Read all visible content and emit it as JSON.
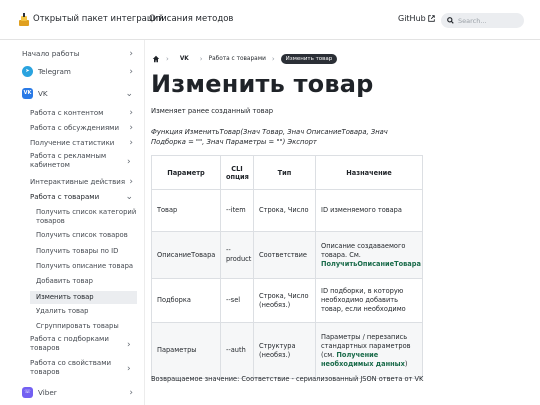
{
  "header": {
    "brand": "Открытый пакет интеграций",
    "nav_methods": "Описания методов",
    "github": "GitHub",
    "search_placeholder": "Search..."
  },
  "sidebar": {
    "start": "Начало работы",
    "telegram": "Telegram",
    "vk": "VK",
    "groups": [
      "Работа с контентом",
      "Работа с обсуждениями",
      "Получение статистики",
      "Работа с рекламным кабинетом",
      "Интерактивные действия",
      "Работа с товарами"
    ],
    "leaves": [
      "Получить список категорий товаров",
      "Получить список товаров",
      "Получить товары по ID",
      "Получить описание товара",
      "Добавить товар",
      "Изменить товар",
      "Удалить товар",
      "Сгруппировать товары"
    ],
    "after": [
      "Работа с подборками товаров",
      "Работа со свойствами товаров"
    ],
    "viber": "Viber"
  },
  "breadcrumbs": {
    "home_icon": "home-icon",
    "vk": "VK",
    "section": "Работа с товарами",
    "current": "Изменить товар"
  },
  "page": {
    "title": "Изменить товар",
    "description": "Изменяет ранее созданный товар",
    "signature": "Функция ИзменитьТовар(Знач Товар, Знач ОписаниеТовара, Знач Подборка = \"\", Знач Параметры = \"\") Экспорт",
    "table": {
      "headers": [
        "Параметр",
        "CLI опция",
        "Тип",
        "Назначение"
      ],
      "rows": [
        {
          "param": "Товар",
          "cli": "--item",
          "type": "Строка, Число",
          "purpose": "ID изменяемого товара",
          "link": "",
          "tail": ""
        },
        {
          "param": "ОписаниеТовара",
          "cli": "--product",
          "type": "Соответствие",
          "purpose": "Описание создаваемого товара. См.",
          "link": "ПолучитьОписаниеТовара",
          "tail": ""
        },
        {
          "param": "Подборка",
          "cli": "--sel",
          "type": "Строка, Число (необяз.)",
          "purpose": "ID подборки, в которую необходимо добавить товар, если необходимо",
          "link": "",
          "tail": ""
        },
        {
          "param": "Параметры",
          "cli": "--auth",
          "type": "Структура (необяз.)",
          "purpose": "Параметры / перезапись стандартных параметров (см.",
          "link": "Получение необходимых данных",
          "tail": ")"
        }
      ]
    },
    "returns": "Возвращаемое значение: Соответствие - сериализованный JSON ответа от VK"
  }
}
